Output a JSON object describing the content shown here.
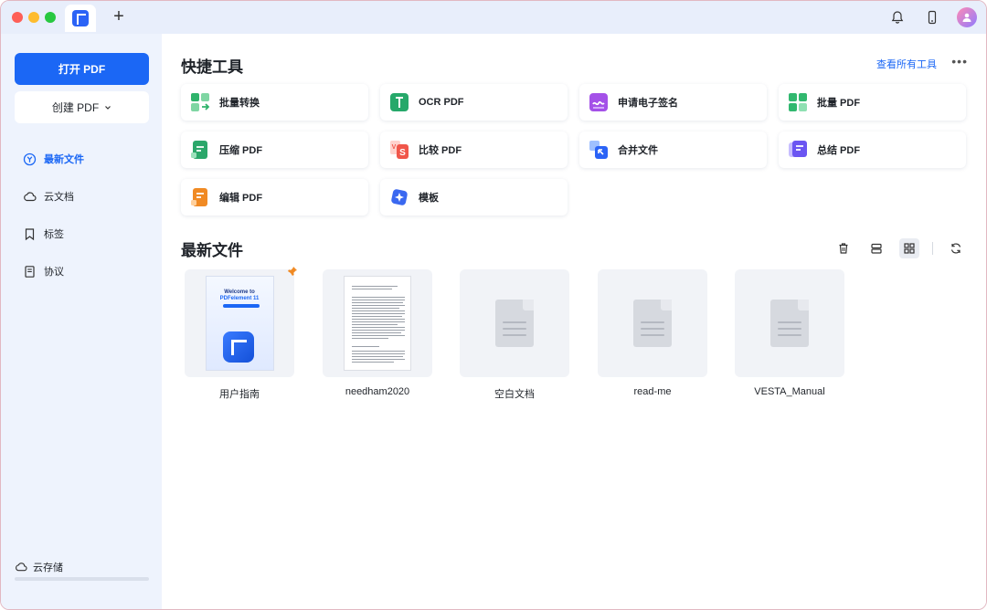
{
  "titlebar": {
    "new_tab_label": "+"
  },
  "sidebar": {
    "open_pdf": "打开 PDF",
    "create_pdf": "创建 PDF",
    "nav": [
      {
        "label": "最新文件",
        "icon": "recent-icon",
        "active": true
      },
      {
        "label": "云文档",
        "icon": "cloud-icon",
        "active": false
      },
      {
        "label": "标签",
        "icon": "bookmark-icon",
        "active": false
      },
      {
        "label": "协议",
        "icon": "document-icon",
        "active": false
      }
    ],
    "cloud_storage": "云存储",
    "storage_used_fraction": 0
  },
  "tools": {
    "title": "快捷工具",
    "view_all": "查看所有工具",
    "items": [
      {
        "label": "批量转换",
        "icon": "batch-convert-icon",
        "color": "#2fb36b"
      },
      {
        "label": "OCR PDF",
        "icon": "ocr-icon",
        "color": "#26a86a"
      },
      {
        "label": "申请电子签名",
        "icon": "esign-icon",
        "color": "#a451e8"
      },
      {
        "label": "批量 PDF",
        "icon": "batch-pdf-icon",
        "color": "#31b86f"
      },
      {
        "label": "压缩 PDF",
        "icon": "compress-icon",
        "color": "#2ba76a"
      },
      {
        "label": "比较 PDF",
        "icon": "compare-icon",
        "color": "#f0564a"
      },
      {
        "label": "合并文件",
        "icon": "merge-icon",
        "color": "#2b63f6"
      },
      {
        "label": "总结 PDF",
        "icon": "summarize-icon",
        "color": "#6b55f2"
      },
      {
        "label": "编辑 PDF",
        "icon": "edit-icon",
        "color": "#f08a24"
      },
      {
        "label": "模板",
        "icon": "template-icon",
        "color": "#3a68f0"
      }
    ]
  },
  "recent": {
    "title": "最新文件",
    "files": [
      {
        "name": "用户指南",
        "kind": "guide",
        "pinned": true,
        "cover_line1": "Welcome to",
        "cover_line2": "PDFelement 11"
      },
      {
        "name": "needham2020",
        "kind": "paper",
        "pinned": false
      },
      {
        "name": "空白文档",
        "kind": "generic",
        "pinned": false
      },
      {
        "name": "read-me",
        "kind": "generic",
        "pinned": false
      },
      {
        "name": "VESTA_Manual",
        "kind": "generic",
        "pinned": false
      }
    ]
  },
  "colors": {
    "accent": "#1b67f5",
    "sidebar_bg": "#eef3fd",
    "titlebar_bg": "#e8eefb"
  }
}
